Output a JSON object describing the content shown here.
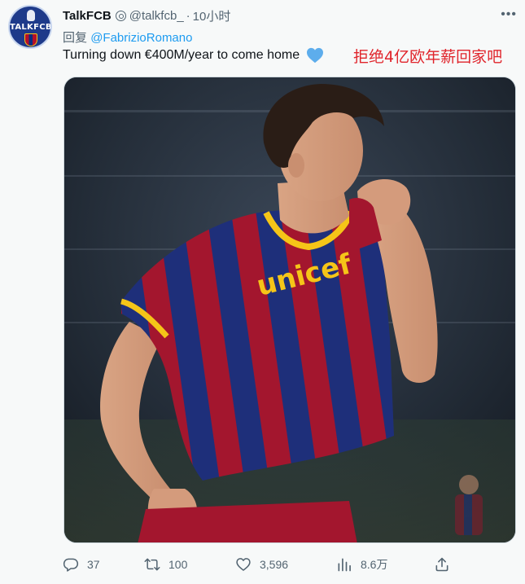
{
  "account": {
    "avatar_text": "TALKFCB",
    "name": "TalkFCB",
    "handle": "@talkfcb_",
    "separator": "·",
    "time": "10小时"
  },
  "reply": {
    "prefix": "回复",
    "mention": "@FabrizioRomano"
  },
  "tweet": {
    "text": "Turning down €400M/year to come home",
    "heart_icon": "blue-heart-emoji",
    "overlay_caption": "拒绝4亿欧年薪回家吧"
  },
  "media": {
    "jersey_sponsor": "unicef"
  },
  "metrics": {
    "replies": "37",
    "retweets": "100",
    "likes": "3,596",
    "views": "8.6万"
  },
  "colors": {
    "accent": "#1d9bf0",
    "muted": "#536471",
    "caption_red": "#e0242b",
    "heart_blue": "#5dadec"
  }
}
